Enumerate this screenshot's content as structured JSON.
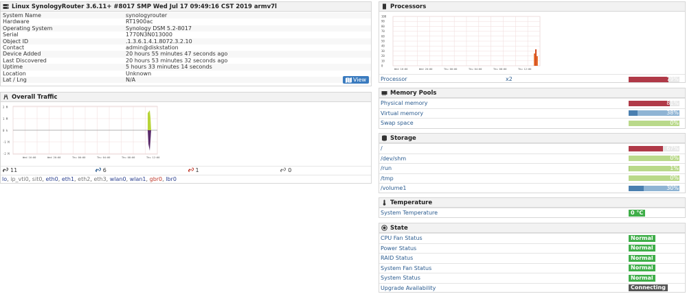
{
  "overview": {
    "title": "Linux SynologyRouter 3.6.11+ #8017 SMP Wed Jul 17 09:49:16 CST 2019 armv7l",
    "rows": [
      {
        "k": "System Name",
        "v": "synologyrouter"
      },
      {
        "k": "Hardware",
        "v": "RT1900ac"
      },
      {
        "k": "Operating System",
        "v": "Synology DSM 5.2-8017"
      },
      {
        "k": "Serial",
        "v": "1770N3N013000"
      },
      {
        "k": "Object ID",
        "v": ".1.3.6.1.4.1.8072.3.2.10"
      },
      {
        "k": "Contact",
        "v": "admin@diskstation"
      },
      {
        "k": "Device Added",
        "v": "20 hours 55 minutes 47 seconds ago"
      },
      {
        "k": "Last Discovered",
        "v": "20 hours 53 minutes 32 seconds ago"
      },
      {
        "k": "Uptime",
        "v": "5 hours 33 minutes 14 seconds"
      },
      {
        "k": "Location",
        "v": "Unknown"
      },
      {
        "k": "Lat / Lng",
        "v": "N/A"
      }
    ],
    "view_label": "View"
  },
  "traffic": {
    "title": "Overall Traffic",
    "y_ticks": [
      "2 M",
      "1 M",
      "0 k",
      "-1 M",
      "-2 M"
    ],
    "x_ticks": [
      "Wed 16:00",
      "Wed 20:00",
      "Thu 00:00",
      "Thu 04:00",
      "Thu 08:00",
      "Thu 12:00"
    ],
    "stats": [
      {
        "icon": "link-icon",
        "value": "11",
        "color": "#444444"
      },
      {
        "icon": "link-up-icon",
        "value": "6",
        "color": "#2a5b8f"
      },
      {
        "icon": "link-down-icon",
        "value": "1",
        "color": "#c0392b"
      },
      {
        "icon": "link-disabled-icon",
        "value": "0",
        "color": "#777777"
      }
    ],
    "ports": [
      {
        "name": "lo",
        "color": "#2a3f8f"
      },
      {
        "name": "ip_vti0",
        "color": "#777777"
      },
      {
        "name": "sit0",
        "color": "#777777"
      },
      {
        "name": "eth0",
        "color": "#2a3f8f"
      },
      {
        "name": "eth1",
        "color": "#2a3f8f"
      },
      {
        "name": "eth2",
        "color": "#777777"
      },
      {
        "name": "eth3",
        "color": "#777777"
      },
      {
        "name": "wlan0",
        "color": "#2a3f8f"
      },
      {
        "name": "wlan1",
        "color": "#2a3f8f"
      },
      {
        "name": "gbr0",
        "color": "#c0392b"
      },
      {
        "name": "lbr0",
        "color": "#2a3f8f"
      }
    ]
  },
  "processors": {
    "title": "Processors",
    "y_ticks": [
      "100",
      "90",
      "80",
      "70",
      "60",
      "50",
      "40",
      "30",
      "20",
      "10",
      "0"
    ],
    "x_ticks": [
      "Wed 16:00",
      "Wed 20:00",
      "Thu 00:00",
      "Thu 04:00",
      "Thu 08:00",
      "Thu 12:00"
    ],
    "row": {
      "label": "Processor",
      "count": "x2",
      "pct": 79,
      "pct_label": "79%"
    }
  },
  "memory": {
    "title": "Memory Pools",
    "rows": [
      {
        "label": "Physical memory",
        "pct": 81,
        "pct_label": "81%",
        "color": "#b03a48",
        "fill2": 0
      },
      {
        "label": "Virtual memory",
        "pct": 18,
        "pct_label": "38%",
        "color": "#4a7fb0",
        "fill2": 20
      },
      {
        "label": "Swap space",
        "pct": 0,
        "pct_label": "0%",
        "color": "#9cc46a",
        "fill2": 0
      }
    ]
  },
  "storage": {
    "title": "Storage",
    "rows": [
      {
        "label": "/",
        "pct": 67,
        "pct_label": "67%",
        "color": "#b03a48"
      },
      {
        "label": "/dev/shm",
        "pct": 0,
        "pct_label": "0%",
        "color": "#9cc46a"
      },
      {
        "label": "/run",
        "pct": 1,
        "pct_label": "1%",
        "color": "#9cc46a"
      },
      {
        "label": "/tmp",
        "pct": 0,
        "pct_label": "0%",
        "color": "#9cc46a"
      },
      {
        "label": "/volume1",
        "pct": 30,
        "pct_label": "30%",
        "color": "#4a7fb0"
      }
    ]
  },
  "temperature": {
    "title": "Temperature",
    "rows": [
      {
        "label": "System Temperature",
        "value": "0 °C",
        "color": "#3fae49"
      }
    ]
  },
  "state": {
    "title": "State",
    "rows": [
      {
        "label": "CPU Fan Status",
        "value": "Normal",
        "color": "#3fae49"
      },
      {
        "label": "Power Status",
        "value": "Normal",
        "color": "#3fae49"
      },
      {
        "label": "RAID Status",
        "value": "Normal",
        "color": "#3fae49"
      },
      {
        "label": "System Fan Status",
        "value": "Normal",
        "color": "#3fae49"
      },
      {
        "label": "System Status",
        "value": "Normal",
        "color": "#3fae49"
      },
      {
        "label": "Upgrade Availability",
        "value": "Connecting",
        "color": "#555555"
      }
    ]
  }
}
